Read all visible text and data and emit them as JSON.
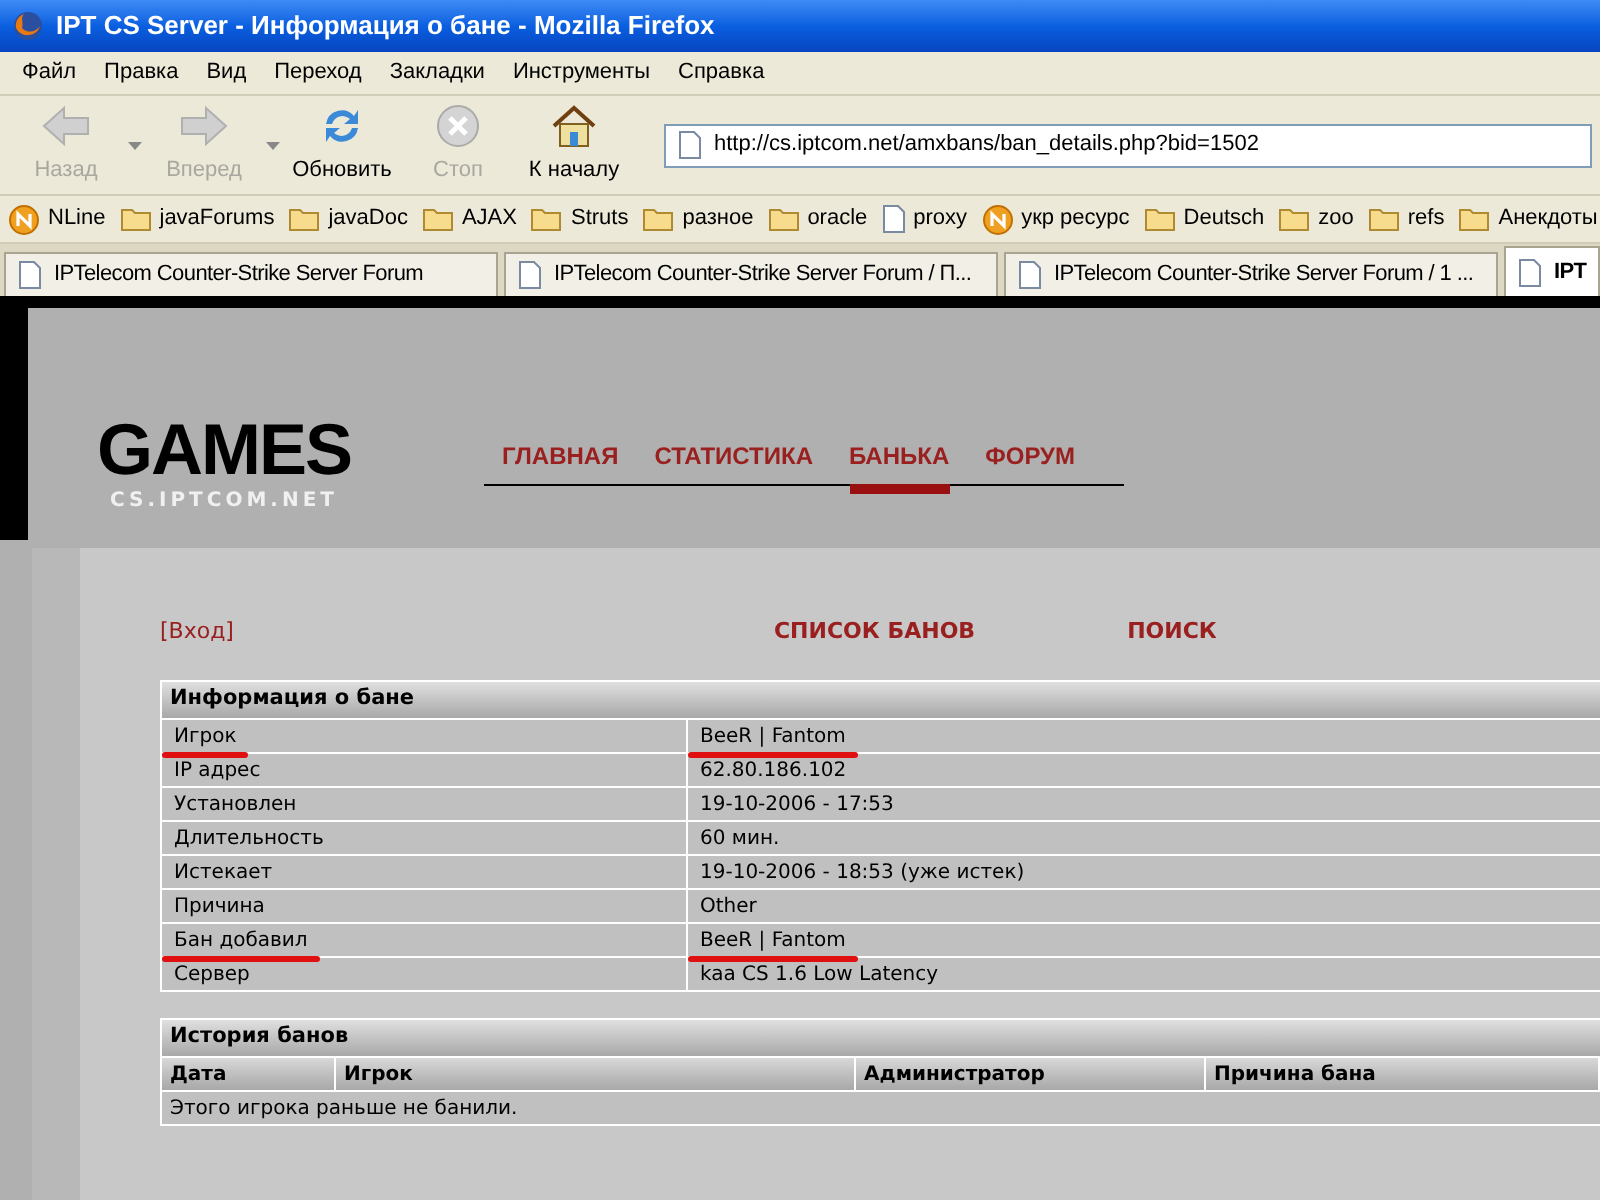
{
  "window": {
    "title": "IPT CS Server - Информация о бане - Mozilla Firefox"
  },
  "menu": [
    "Файл",
    "Правка",
    "Вид",
    "Переход",
    "Закладки",
    "Инструменты",
    "Справка"
  ],
  "toolbar": [
    {
      "kind": "back",
      "label": "Назад",
      "disabled": true,
      "dropdown": true
    },
    {
      "kind": "forward",
      "label": "Вперед",
      "disabled": true,
      "dropdown": true
    },
    {
      "kind": "reload",
      "label": "Обновить",
      "disabled": false,
      "dropdown": false
    },
    {
      "kind": "stop",
      "label": "Стоп",
      "disabled": true,
      "dropdown": false
    },
    {
      "kind": "home",
      "label": "К началу",
      "disabled": false,
      "dropdown": false
    }
  ],
  "address": {
    "value": "http://cs.iptcom.net/amxbans/ban_details.php?bid=1502"
  },
  "bookmarks": [
    {
      "kind": "live",
      "label": "NLine"
    },
    {
      "kind": "folder",
      "label": "javaForums"
    },
    {
      "kind": "folder",
      "label": "javaDoc"
    },
    {
      "kind": "folder",
      "label": "AJAX"
    },
    {
      "kind": "folder",
      "label": "Struts"
    },
    {
      "kind": "folder",
      "label": "разное"
    },
    {
      "kind": "folder",
      "label": "oracle"
    },
    {
      "kind": "page",
      "label": "proxy"
    },
    {
      "kind": "live",
      "label": "укр ресурс"
    },
    {
      "kind": "folder",
      "label": "Deutsch"
    },
    {
      "kind": "folder",
      "label": "zoo"
    },
    {
      "kind": "folder",
      "label": "refs"
    },
    {
      "kind": "folder",
      "label": "Анекдоты"
    }
  ],
  "tabs": [
    {
      "label": "IPTelecom Counter-Strike Server Forum",
      "selected": false
    },
    {
      "label": "IPTelecom Counter-Strike Server Forum / П...",
      "selected": false
    },
    {
      "label": "IPTelecom Counter-Strike Server Forum / 1 ...",
      "selected": false
    },
    {
      "label": "IPT",
      "selected": true
    }
  ],
  "site": {
    "logo": "GAMES",
    "logo_subtitle": "CS.IPTCOM.NET",
    "nav": [
      {
        "label": "ГЛАВНАЯ",
        "selected": false
      },
      {
        "label": "СТАТИСТИКА",
        "selected": false
      },
      {
        "label": "БАНЬКА",
        "selected": true
      },
      {
        "label": "ФОРУМ",
        "selected": false
      }
    ],
    "login_link": "[Вход]",
    "sub_nav": [
      "СПИСОК БАНОВ",
      "ПОИСК"
    ]
  },
  "ban_info": {
    "title": "Информация о бане",
    "rows": [
      {
        "label": "Игрок",
        "value": "BeeR | Fantom",
        "underlined": true
      },
      {
        "label": "IP адрес",
        "value": "62.80.186.102",
        "underlined": false
      },
      {
        "label": "Установлен",
        "value": "19-10-2006 - 17:53",
        "underlined": false
      },
      {
        "label": "Длительность",
        "value": "60 мин.",
        "underlined": false
      },
      {
        "label": "Истекает",
        "value": "19-10-2006 - 18:53 (уже истек)",
        "underlined": false
      },
      {
        "label": "Причина",
        "value": "Other",
        "underlined": false
      },
      {
        "label": "Бан добавил",
        "value": "BeeR | Fantom",
        "underlined": true
      },
      {
        "label": "Сервер",
        "value": "kaa CS 1.6 Low Latency",
        "underlined": false
      }
    ]
  },
  "ban_history": {
    "title": "История банов",
    "columns": [
      "Дата",
      "Игрок",
      "Администратор",
      "Причина бана"
    ],
    "empty_message": "Этого игрока раньше не банили."
  }
}
